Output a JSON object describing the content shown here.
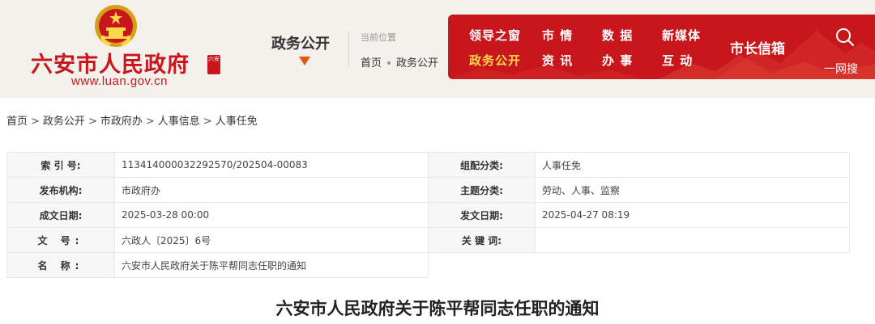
{
  "header": {
    "site_title": "六安市人民政府",
    "site_url": "www.luan.gov.cn",
    "seal_text": "六安",
    "column_name": "政务公开",
    "location_label": "当前位置",
    "location_trail": [
      "首页",
      "政务公开"
    ]
  },
  "nav": {
    "row1": [
      "领导之窗",
      "市 情",
      "数 据",
      "新媒体"
    ],
    "row2": [
      "政务公开",
      "资 讯",
      "办 事",
      "互 动"
    ],
    "active": "政务公开",
    "mayor_mailbox": "市长信箱",
    "search_label": "一网搜"
  },
  "breadcrumb": [
    "首页",
    "政务公开",
    "市政府办",
    "人事信息",
    "人事任免"
  ],
  "meta": {
    "index_no_label": "索 引 号:",
    "index_no": "113414000032292570/202504-00083",
    "category_label": "组配分类:",
    "category": "人事任免",
    "publisher_label": "发布机构:",
    "publisher": "市政府办",
    "topic_label": "主题分类:",
    "topic": "劳动、人事、监察",
    "written_date_label": "成文日期:",
    "written_date": "2025-03-28 00:00",
    "publish_date_label": "发文日期:",
    "publish_date": "2025-04-27 08:19",
    "doc_no_label": "文 号:",
    "doc_no": "六政人〔2025〕6号",
    "keywords_label": "关 键 词:",
    "keywords": "",
    "name_label": "名 称:",
    "name": "六安市人民政府关于陈平帮同志任职的通知"
  },
  "document": {
    "title": "六安市人民政府关于陈平帮同志任职的通知"
  },
  "colors": {
    "brand_red": "#c8161d",
    "active_yellow": "#ffd84a",
    "arrow_orange": "#e0590c",
    "header_bg": "#f4f1ec"
  },
  "icons": {
    "emblem": "national-emblem-icon",
    "search": "search-icon",
    "arrow": "triangle-down-icon"
  }
}
